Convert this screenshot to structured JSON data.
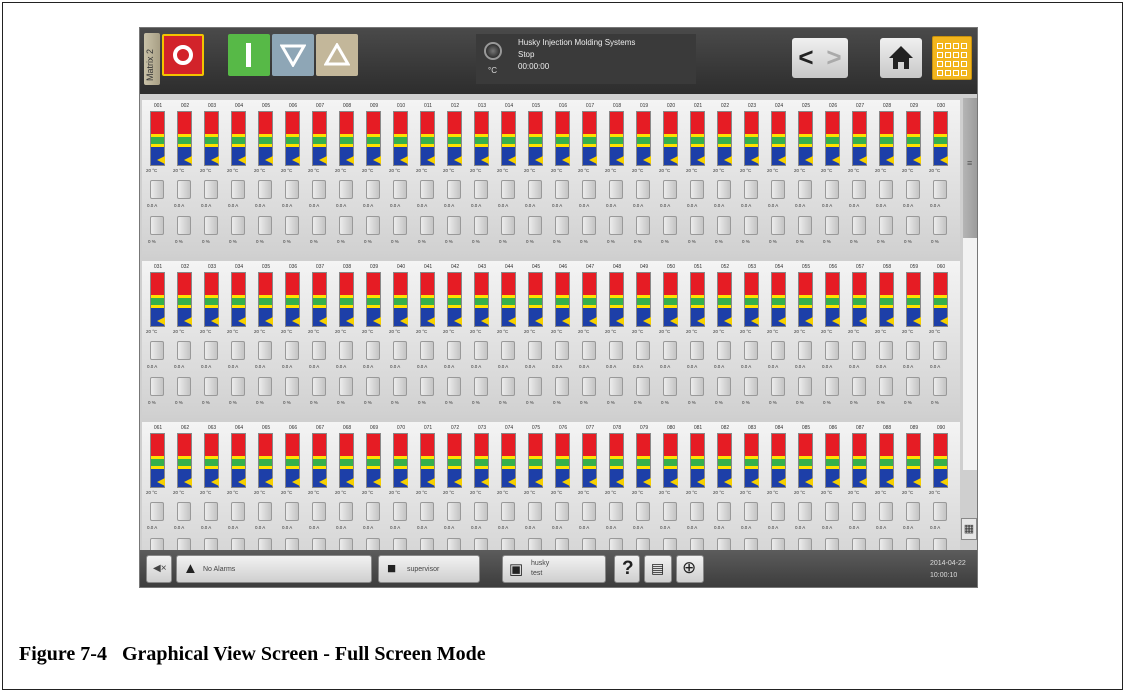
{
  "header": {
    "matrix_tab": "Matrix 2",
    "status_title": "Husky Injection Molding Systems",
    "status_state": "Stop",
    "status_timer": "00:00:00",
    "temperature_unit": "°C",
    "nav_back_glyph": "<",
    "nav_forward_glyph": ">",
    "icons": [
      "power-off-icon",
      "power-on-icon",
      "decrease-icon",
      "increase-icon",
      "home-icon",
      "grid-view-icon"
    ]
  },
  "zones": [
    {
      "ids": [
        "001",
        "002",
        "003",
        "004",
        "005",
        "006",
        "007",
        "008",
        "009",
        "010",
        "011",
        "012",
        "013",
        "014",
        "015",
        "016",
        "017",
        "018",
        "019",
        "020",
        "021",
        "022",
        "023",
        "024",
        "025",
        "026",
        "027",
        "028",
        "029",
        "030"
      ]
    },
    {
      "ids": [
        "031",
        "032",
        "033",
        "034",
        "035",
        "036",
        "037",
        "038",
        "039",
        "040",
        "041",
        "042",
        "043",
        "044",
        "045",
        "046",
        "047",
        "048",
        "049",
        "050",
        "051",
        "052",
        "053",
        "054",
        "055",
        "056",
        "057",
        "058",
        "059",
        "060"
      ]
    },
    {
      "ids": [
        "061",
        "062",
        "063",
        "064",
        "065",
        "066",
        "067",
        "068",
        "069",
        "070",
        "071",
        "072",
        "073",
        "074",
        "075",
        "076",
        "077",
        "078",
        "079",
        "080",
        "081",
        "082",
        "083",
        "084",
        "085",
        "086",
        "087",
        "088",
        "089",
        "090"
      ]
    }
  ],
  "zone_defaults": {
    "temperature": "20 °C",
    "current": "0.0 A",
    "power": "0 %"
  },
  "scroll_position": 0,
  "footer": {
    "alarms_label": "No Alarms",
    "user_label": "supervisor",
    "mold_name": "husky",
    "mold_sub": "test",
    "help_glyph": "?",
    "date": "2014-04-22",
    "time": "10:00:10"
  },
  "caption": {
    "figure": "Figure 7-4",
    "title": "Graphical View Screen - Full Screen Mode"
  }
}
